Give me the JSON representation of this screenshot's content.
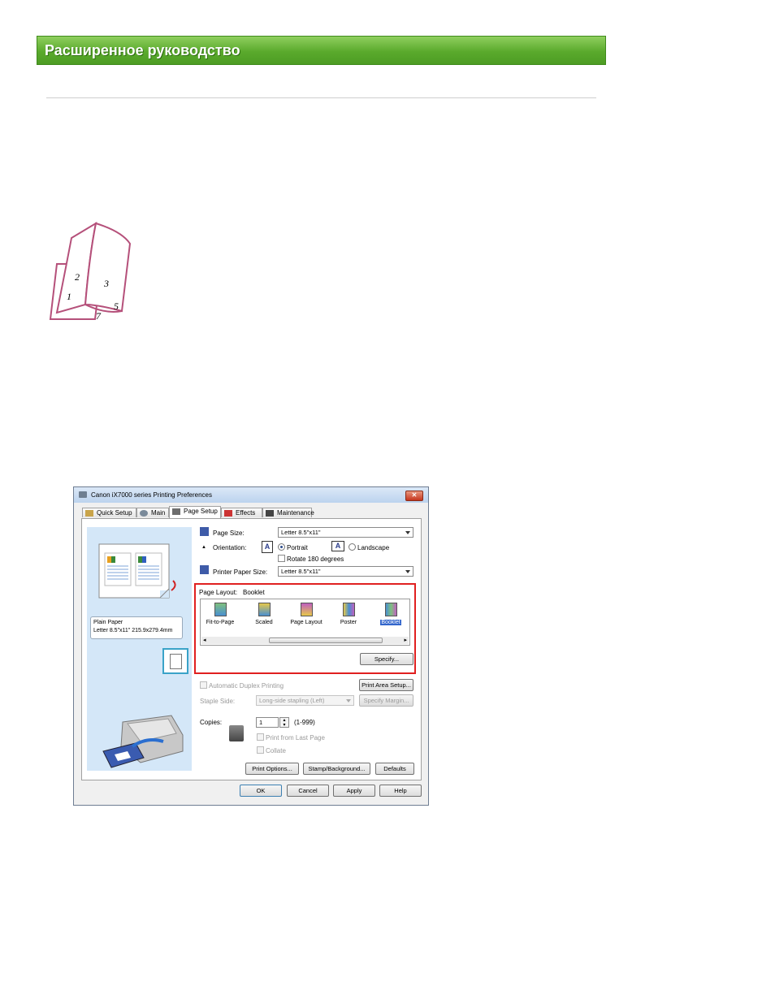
{
  "header": {
    "title": "Расширенное руководство"
  },
  "illustration": {
    "page_numbers": [
      "2",
      "3",
      "1",
      "5",
      "7"
    ]
  },
  "dialog": {
    "title": "Canon iX7000 series Printing Preferences",
    "tabs": [
      {
        "label": "Quick Setup",
        "icon": "quick-setup-icon"
      },
      {
        "label": "Main",
        "icon": "main-icon"
      },
      {
        "label": "Page Setup",
        "icon": "page-setup-icon",
        "active": true
      },
      {
        "label": "Effects",
        "icon": "effects-icon"
      },
      {
        "label": "Maintenance",
        "icon": "maintenance-icon"
      }
    ],
    "preview": {
      "paper_type": "Plain Paper",
      "paper_size": "Letter 8.5\"x11\" 215.9x279.4mm"
    },
    "page_size": {
      "label": "Page Size:",
      "value": "Letter 8.5\"x11\""
    },
    "orientation": {
      "label": "Orientation:",
      "portrait": "Portrait",
      "landscape": "Landscape",
      "selected": "Portrait",
      "rotate_label": "Rotate 180 degrees"
    },
    "printer_paper_size": {
      "label": "Printer Paper Size:",
      "value": "Letter 8.5\"x11\""
    },
    "page_layout": {
      "label": "Page Layout:",
      "value": "Booklet",
      "items": [
        "Fit-to-Page",
        "Scaled",
        "Page Layout",
        "Poster",
        "Booklet"
      ],
      "selected": "Booklet",
      "specify_label": "Specify..."
    },
    "duplex": {
      "label": "Automatic Duplex Printing",
      "print_area_label": "Print Area Setup..."
    },
    "staple": {
      "label": "Staple Side:",
      "value": "Long-side stapling (Left)",
      "margin_label": "Specify Margin..."
    },
    "copies": {
      "label": "Copies:",
      "value": "1",
      "range": "(1-999)",
      "last_page_label": "Print from Last Page",
      "collate_label": "Collate"
    },
    "panel_buttons": {
      "print_options": "Print Options...",
      "stamp": "Stamp/Background...",
      "defaults": "Defaults"
    },
    "footer_buttons": {
      "ok": "OK",
      "cancel": "Cancel",
      "apply": "Apply",
      "help": "Help"
    },
    "colors": {
      "highlight_box": "#e02020",
      "selection": "#3366cc",
      "preview_bg": "#d4e7f8"
    }
  }
}
